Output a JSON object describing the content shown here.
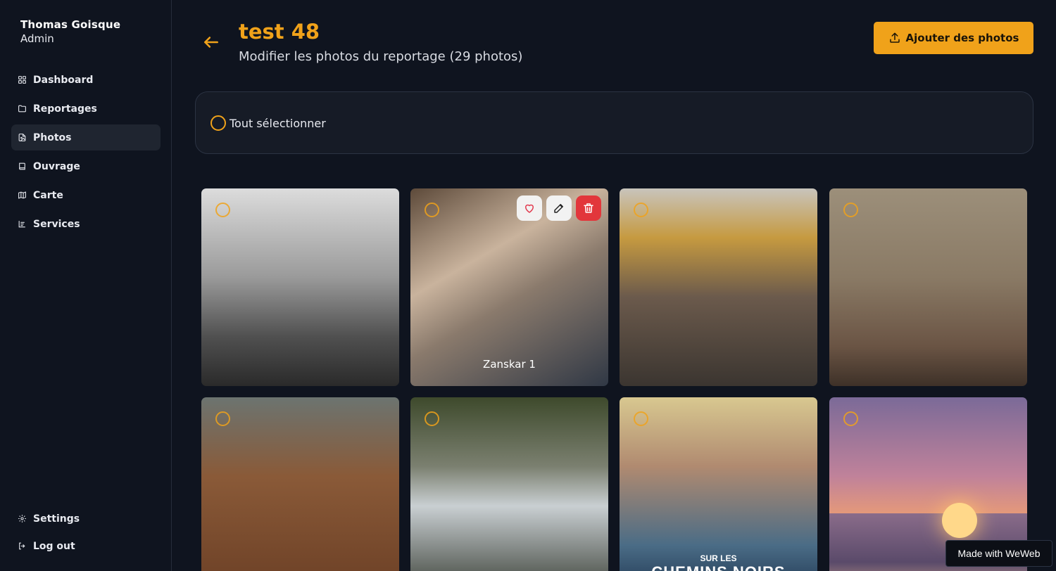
{
  "user": {
    "name": "Thomas Goisque",
    "role": "Admin"
  },
  "nav": [
    {
      "label": "Dashboard",
      "icon": "grid-icon"
    },
    {
      "label": "Reportages",
      "icon": "folder-icon"
    },
    {
      "label": "Photos",
      "icon": "image-file-icon",
      "active": true
    },
    {
      "label": "Ouvrage",
      "icon": "book-icon"
    },
    {
      "label": "Carte",
      "icon": "map-icon"
    },
    {
      "label": "Services",
      "icon": "list-icon"
    }
  ],
  "nav_bottom": [
    {
      "label": "Settings",
      "icon": "gear-icon"
    },
    {
      "label": "Log out",
      "icon": "logout-icon"
    }
  ],
  "header": {
    "title": "test 48",
    "subtitle": "Modifier les photos du reportage (29 photos)",
    "add_label": "Ajouter des photos"
  },
  "select_bar": {
    "label": "Tout sélectionner"
  },
  "photos": [
    {
      "caption": ""
    },
    {
      "caption": "Zanskar 1"
    },
    {
      "caption": ""
    },
    {
      "caption": ""
    },
    {
      "caption": ""
    },
    {
      "caption": ""
    },
    {
      "caption": "",
      "poster_small": "SUR LES",
      "poster_big": "CHEMINS NOIRS"
    },
    {
      "caption": ""
    }
  ],
  "badge": "Made with WeWeb",
  "colors": {
    "accent": "#f0a21a",
    "background": "#0f141f",
    "danger": "#e2363b"
  }
}
